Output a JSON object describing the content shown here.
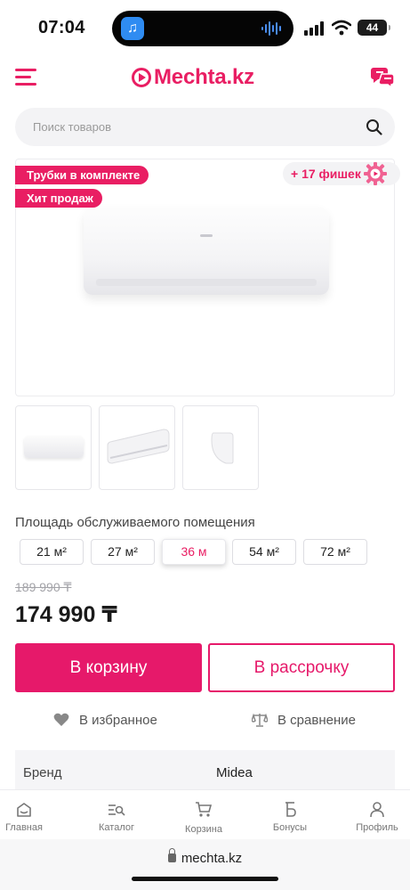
{
  "status_bar": {
    "time": "07:04",
    "battery": "44"
  },
  "header": {
    "logo": "Mechta.kz"
  },
  "search": {
    "placeholder": "Поиск товаров"
  },
  "badges": [
    "Трубки в комплекте",
    "Хит продаж"
  ],
  "chips_label": "+ 17 фишек",
  "area": {
    "label": "Площадь обслуживаемого помещения",
    "options": [
      "21 м²",
      "27 м²",
      "36 м",
      "54 м²",
      "72 м²"
    ],
    "selected": "36 м"
  },
  "price": {
    "old": "189 990 ₸",
    "current": "174 990 ₸"
  },
  "buttons": {
    "cart": "В корзину",
    "installment": "В рассрочку"
  },
  "actions": {
    "favorite": "В избранное",
    "compare": "В сравнение"
  },
  "specs": [
    {
      "key": "Бренд",
      "value": "Midea"
    }
  ],
  "nav": {
    "items": [
      {
        "label": "Главная",
        "icon": "home-icon"
      },
      {
        "label": "Каталог",
        "icon": "catalog-icon"
      },
      {
        "label": "Корзина",
        "icon": "cart-icon"
      },
      {
        "label": "Бонусы",
        "icon": "bonus-icon"
      },
      {
        "label": "Профиль",
        "icon": "profile-icon"
      }
    ]
  },
  "browser": {
    "url": "mechta.kz"
  },
  "colors": {
    "accent": "#e91e63"
  }
}
